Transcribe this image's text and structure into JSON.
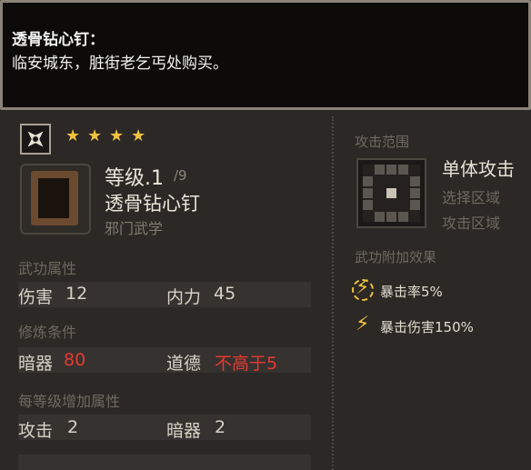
{
  "tooltip": {
    "title": "透骨钻心钉：",
    "body": "临安城东，脏街老乞丐处购买。"
  },
  "item": {
    "stars": [
      "★",
      "★",
      "★",
      "★"
    ],
    "level_label": "等级.1",
    "level_max": "/9",
    "name": "透骨钻心钉",
    "school": "邪门武学"
  },
  "attributes": {
    "title": "武功属性",
    "damage_label": "伤害",
    "damage_value": "12",
    "internal_label": "内力",
    "internal_value": "45"
  },
  "requirements": {
    "title": "修炼条件",
    "hidden_weapon_label": "暗器",
    "hidden_weapon_value": "80",
    "morality_label": "道德",
    "morality_value": "不高于5",
    "value_color": "#e53a2f"
  },
  "per_level": {
    "title": "每等级增加属性",
    "attack_label": "攻击",
    "attack_value": "2",
    "hidden_weapon_label": "暗器",
    "hidden_weapon_value": "2"
  },
  "range": {
    "title": "攻击范围",
    "type": "单体攻击",
    "select_area": "选择区域",
    "attack_area": "攻击区域"
  },
  "effects": {
    "title": "武功附加效果",
    "items": [
      {
        "icon": "lightning-ring-icon",
        "text": "暴击率5%"
      },
      {
        "icon": "lightning-icon",
        "text": "暴击伤害150%"
      }
    ]
  },
  "colors": {
    "accent_gold": "#f0c040",
    "requirement_red": "#e53a2f"
  }
}
